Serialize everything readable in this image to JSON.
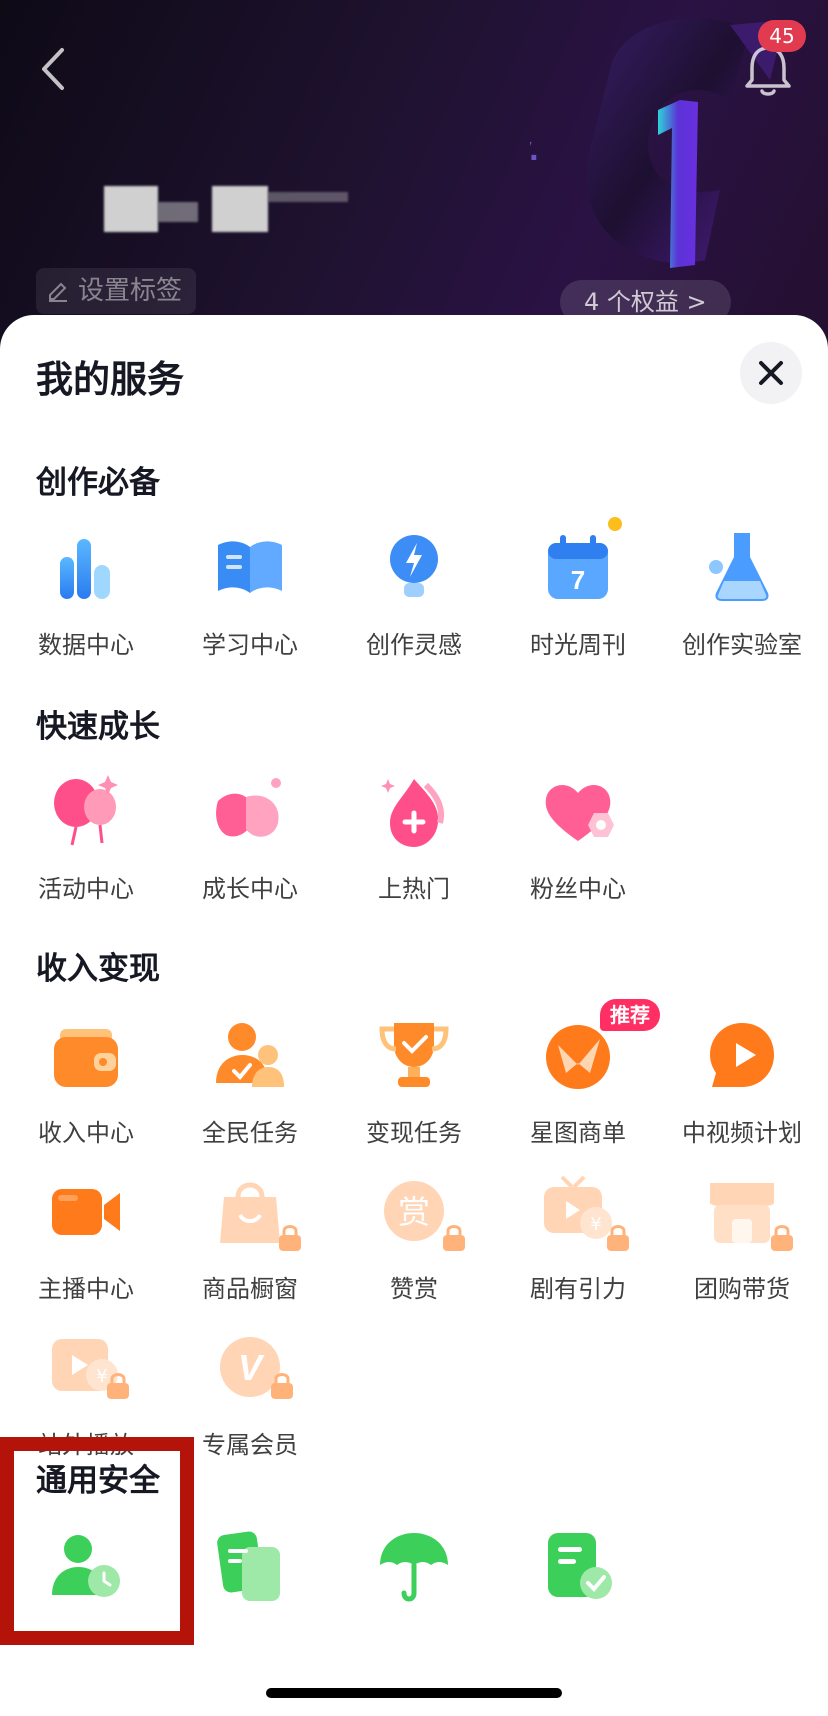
{
  "header": {
    "notification_count": "45",
    "level_badge": "Lv.",
    "level_number": "1",
    "set_tag_label": "设置标签",
    "benefits_label": "4 个权益 >"
  },
  "sheet": {
    "title": "我的服务",
    "sections": [
      {
        "title": "创作必备",
        "items": [
          {
            "label": "数据中心",
            "icon": "bar-chart-icon"
          },
          {
            "label": "学习中心",
            "icon": "book-icon"
          },
          {
            "label": "创作灵感",
            "icon": "lightbulb-icon"
          },
          {
            "label": "时光周刊",
            "icon": "calendar-icon",
            "calendar_day": "7"
          },
          {
            "label": "创作实验室",
            "icon": "flask-icon"
          }
        ]
      },
      {
        "title": "快速成长",
        "items": [
          {
            "label": "活动中心",
            "icon": "balloon-icon"
          },
          {
            "label": "成长中心",
            "icon": "leaf-icon"
          },
          {
            "label": "上热门",
            "icon": "flame-icon"
          },
          {
            "label": "粉丝中心",
            "icon": "heart-icon"
          }
        ]
      },
      {
        "title": "收入变现",
        "items": [
          {
            "label": "收入中心",
            "icon": "wallet-icon"
          },
          {
            "label": "全民任务",
            "icon": "users-icon"
          },
          {
            "label": "变现任务",
            "icon": "trophy-icon"
          },
          {
            "label": "星图商单",
            "icon": "star-map-icon",
            "badge": "推荐"
          },
          {
            "label": "中视频计划",
            "icon": "play-icon"
          },
          {
            "label": "主播中心",
            "icon": "video-camera-icon"
          },
          {
            "label": "商品橱窗",
            "icon": "shopping-bag-icon",
            "locked": true
          },
          {
            "label": "赞赏",
            "icon": "reward-icon",
            "glyph": "赏",
            "locked": true
          },
          {
            "label": "剧有引力",
            "icon": "tv-coin-icon",
            "coin": "¥",
            "locked": true
          },
          {
            "label": "团购带货",
            "icon": "store-icon",
            "locked": true
          },
          {
            "label": "站外播放",
            "icon": "video-coin-icon",
            "coin": "¥",
            "locked": true
          },
          {
            "label": "专属会员",
            "icon": "vip-icon",
            "glyph": "V",
            "locked": true
          }
        ]
      },
      {
        "title": "通用安全",
        "items": [
          {
            "label": "",
            "icon": "user-clock-icon"
          },
          {
            "label": "",
            "icon": "documents-icon"
          },
          {
            "label": "",
            "icon": "umbrella-icon"
          },
          {
            "label": "",
            "icon": "verified-doc-icon"
          }
        ]
      }
    ]
  }
}
